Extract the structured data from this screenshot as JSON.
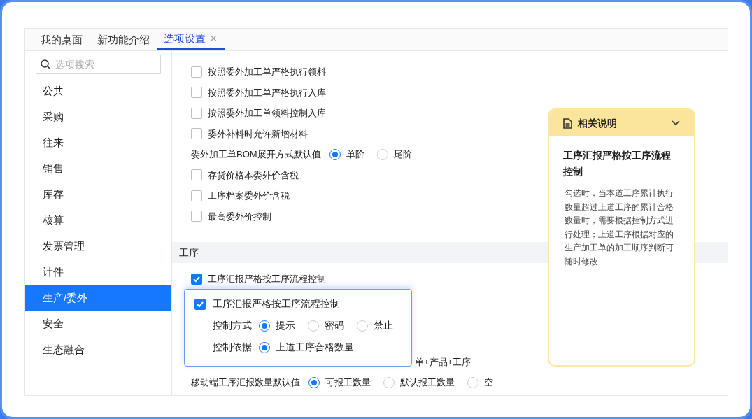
{
  "tabs": [
    {
      "label": "我的桌面",
      "selected": false
    },
    {
      "label": "新功能介绍",
      "selected": false
    },
    {
      "label": "选项设置",
      "selected": true,
      "close_glyph": "×"
    }
  ],
  "search": {
    "placeholder": "选项搜索"
  },
  "sidebar": {
    "items": [
      {
        "label": "公共",
        "selected": false
      },
      {
        "label": "采购",
        "selected": false
      },
      {
        "label": "往来",
        "selected": false
      },
      {
        "label": "销售",
        "selected": false
      },
      {
        "label": "库存",
        "selected": false
      },
      {
        "label": "核算",
        "selected": false
      },
      {
        "label": "发票管理",
        "selected": false
      },
      {
        "label": "计件",
        "selected": false
      },
      {
        "label": "生产/委外",
        "selected": true
      },
      {
        "label": "安全",
        "selected": false
      },
      {
        "label": "生态融合",
        "selected": false
      }
    ]
  },
  "options": [
    {
      "kind": "checkbox",
      "label": "按照委外加工单严格执行领料",
      "checked": false
    },
    {
      "kind": "checkbox",
      "label": "按照委外加工单严格执行入库",
      "checked": false
    },
    {
      "kind": "checkbox",
      "label": "按照委外加工单领料控制入库",
      "checked": false
    },
    {
      "kind": "checkbox",
      "label": "委外补料时允许新增材料",
      "checked": false
    },
    {
      "kind": "radio",
      "label": "委外加工单BOM展开方式默认值",
      "choices": [
        {
          "label": "单阶",
          "selected": true
        },
        {
          "label": "尾阶",
          "selected": false
        }
      ]
    },
    {
      "kind": "checkbox",
      "label": "存货价格本委外价含税",
      "checked": false
    },
    {
      "kind": "checkbox",
      "label": "工序档案委外价含税",
      "checked": false
    },
    {
      "kind": "checkbox",
      "label": "最高委外价控制",
      "checked": false
    }
  ],
  "section": {
    "title": "工序",
    "options": [
      {
        "kind": "checkbox",
        "label": "工序汇报严格按工序流程控制",
        "checked": true
      },
      {
        "kind": "covered",
        "text": "单+产品+工序"
      },
      {
        "kind": "radio",
        "label": "移动端工序汇报数量默认值",
        "choices": [
          {
            "label": "可报工数量",
            "selected": true
          },
          {
            "label": "默认报工数量",
            "selected": false
          },
          {
            "label": "空",
            "selected": false
          }
        ]
      }
    ]
  },
  "popover": {
    "option": {
      "label": "工序汇报严格按工序流程控制",
      "checked": true
    },
    "rows": [
      {
        "label": "控制方式",
        "choices": [
          {
            "label": "提示",
            "selected": true
          },
          {
            "label": "密码",
            "selected": false
          },
          {
            "label": "禁止",
            "selected": false
          }
        ]
      },
      {
        "label": "控制依据",
        "choices": [
          {
            "label": "上道工序合格数量",
            "selected": true
          }
        ]
      }
    ]
  },
  "help": {
    "title": "相关说明",
    "heading": "工序汇报严格按工序流程控制",
    "body": "勾选时，当本道工序累计执行数量超过上道工序的累计合格数量时，需要根据控制方式进行处理；上道工序根据对应的生产加工单的加工顺序判断可随时修改"
  }
}
